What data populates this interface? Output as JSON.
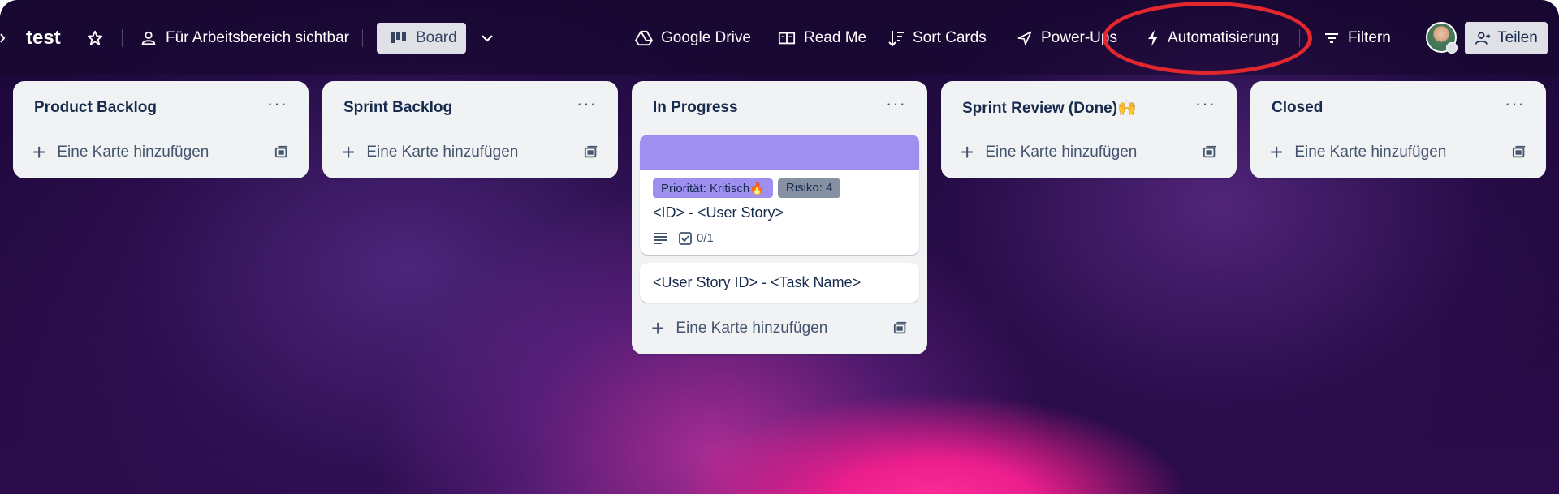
{
  "header": {
    "board_title": "test",
    "visibility_label": "Für Arbeitsbereich sichtbar",
    "view_label": "Board",
    "google_drive_label": "Google Drive",
    "read_me_label": "Read Me",
    "sort_cards_label": "Sort Cards",
    "power_ups_label": "Power-Ups",
    "automation_label": "Automatisierung",
    "filter_label": "Filtern",
    "share_label": "Teilen"
  },
  "lists": [
    {
      "title": "Product Backlog",
      "add_label": "Eine Karte hinzufügen"
    },
    {
      "title": "Sprint Backlog",
      "add_label": "Eine Karte hinzufügen"
    },
    {
      "title": "In Progress",
      "add_label": "Eine Karte hinzufügen"
    },
    {
      "title": "Sprint Review (Done)🙌",
      "add_label": "Eine Karte hinzufügen"
    },
    {
      "title": "Closed",
      "add_label": "Eine Karte hinzufügen"
    }
  ],
  "cards": [
    {
      "labels": [
        {
          "text": "Priorität: Kritisch🔥",
          "color": "#9f8fef"
        },
        {
          "text": "Risiko: 4",
          "color": "#8590a2"
        }
      ],
      "title": "<ID> - <User Story>",
      "checklist": "0/1",
      "cover_color": "#9f8fef"
    },
    {
      "title": "<User Story ID> - <Task Name>"
    }
  ],
  "list_menu_glyph": "···",
  "colors": {
    "highlight_ring": "#e4262f",
    "background_accent": "#e91e8c"
  }
}
